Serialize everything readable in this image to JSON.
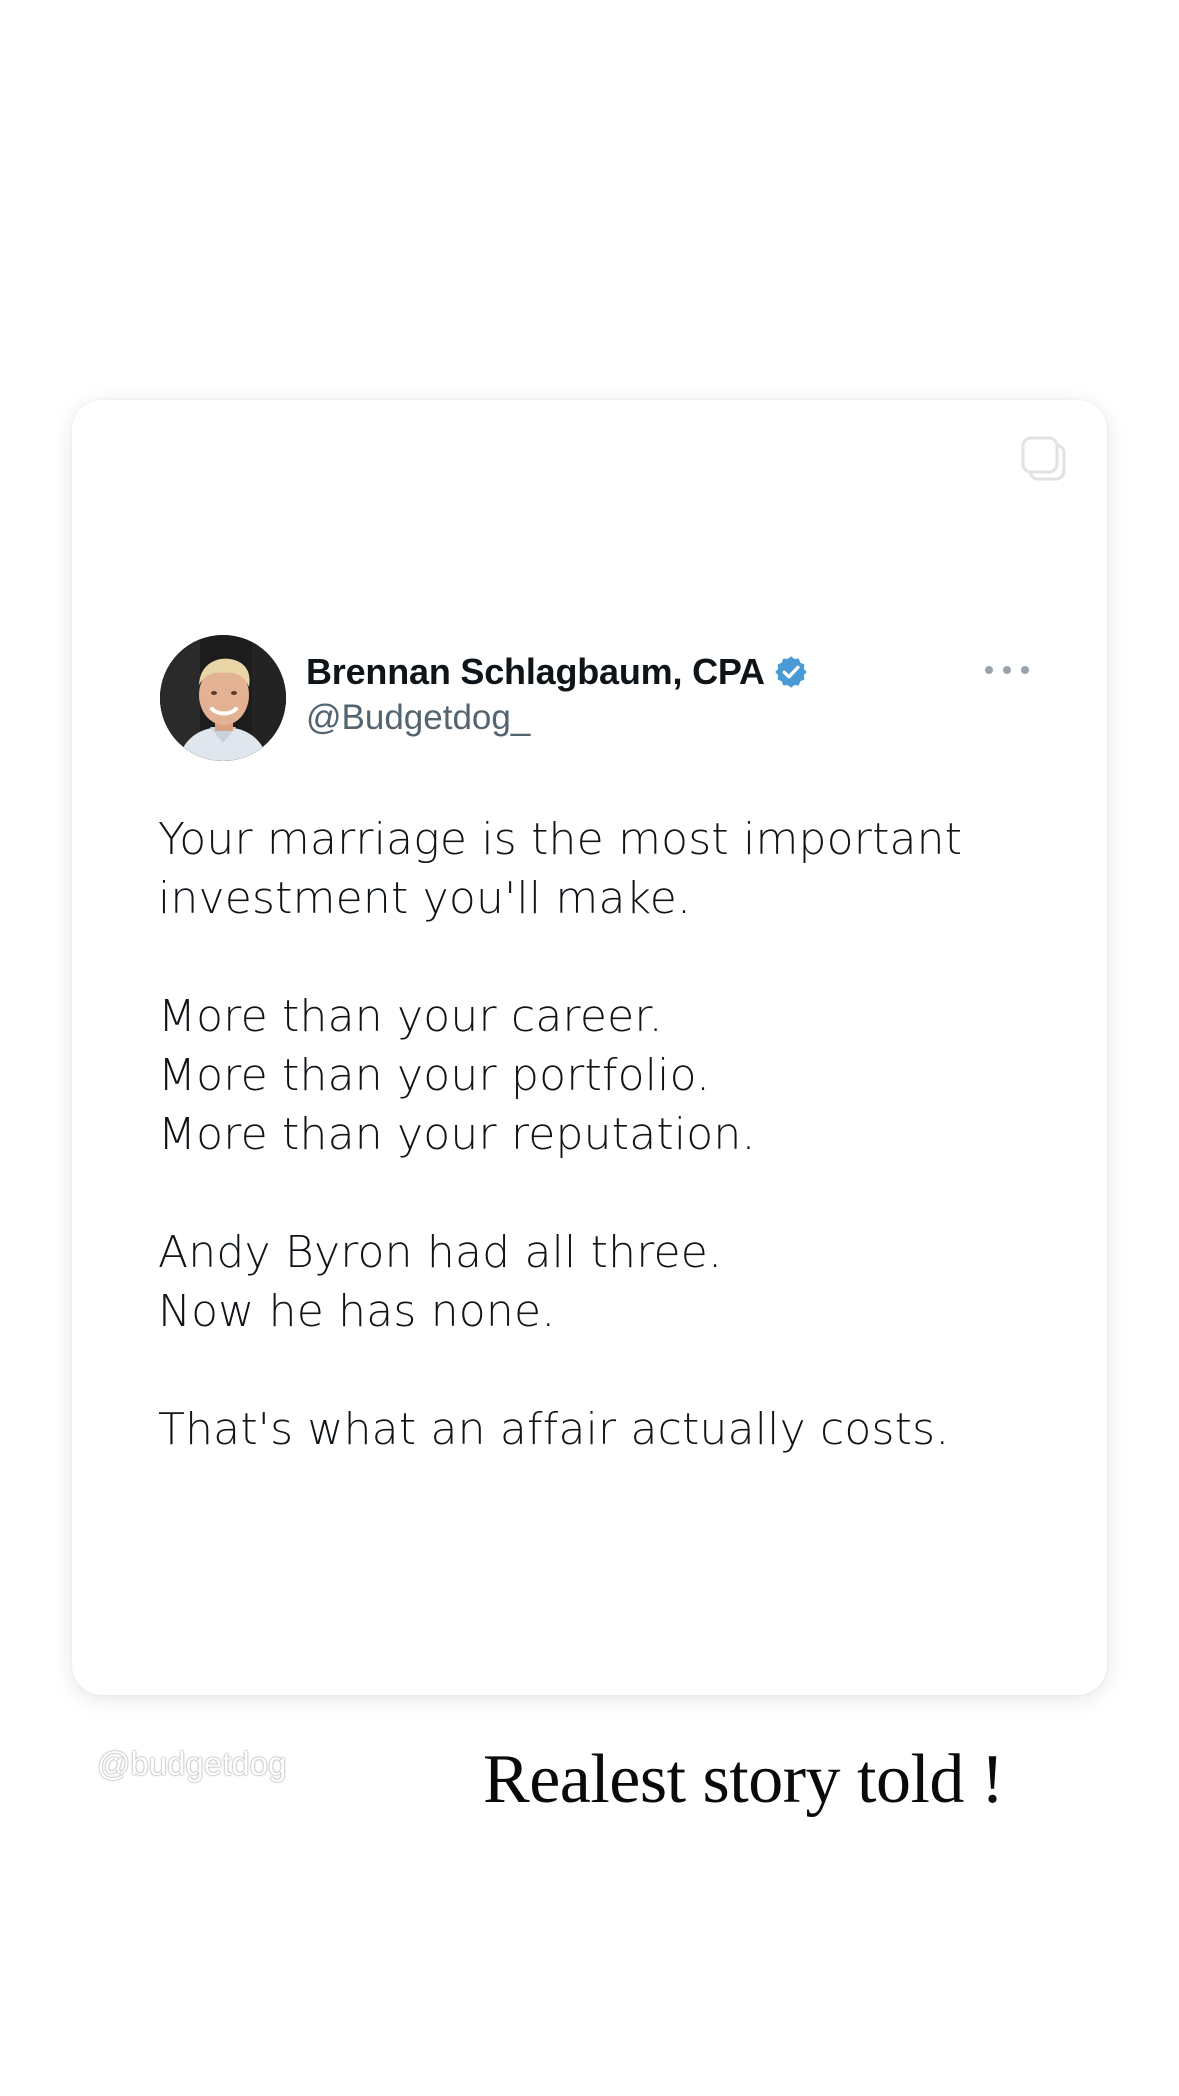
{
  "post": {
    "author_name": "Brennan Schlagbaum, CPA",
    "handle": "@Budgetdog_",
    "verified_color": "#4a9ad6",
    "lines": [
      "Your marriage is the most important",
      "investment you'll make.",
      "",
      "More than your career.",
      "More than your portfolio.",
      "More than your reputation.",
      "",
      "Andy Byron had all three.",
      "Now he has none.",
      "",
      "That's what an affair actually costs."
    ]
  },
  "icons": {
    "copy": "copy-icon",
    "verified": "verified-badge-icon",
    "more": "more-options-icon"
  },
  "story": {
    "watermark": "@budgetdog",
    "caption": "Realest story told !"
  }
}
